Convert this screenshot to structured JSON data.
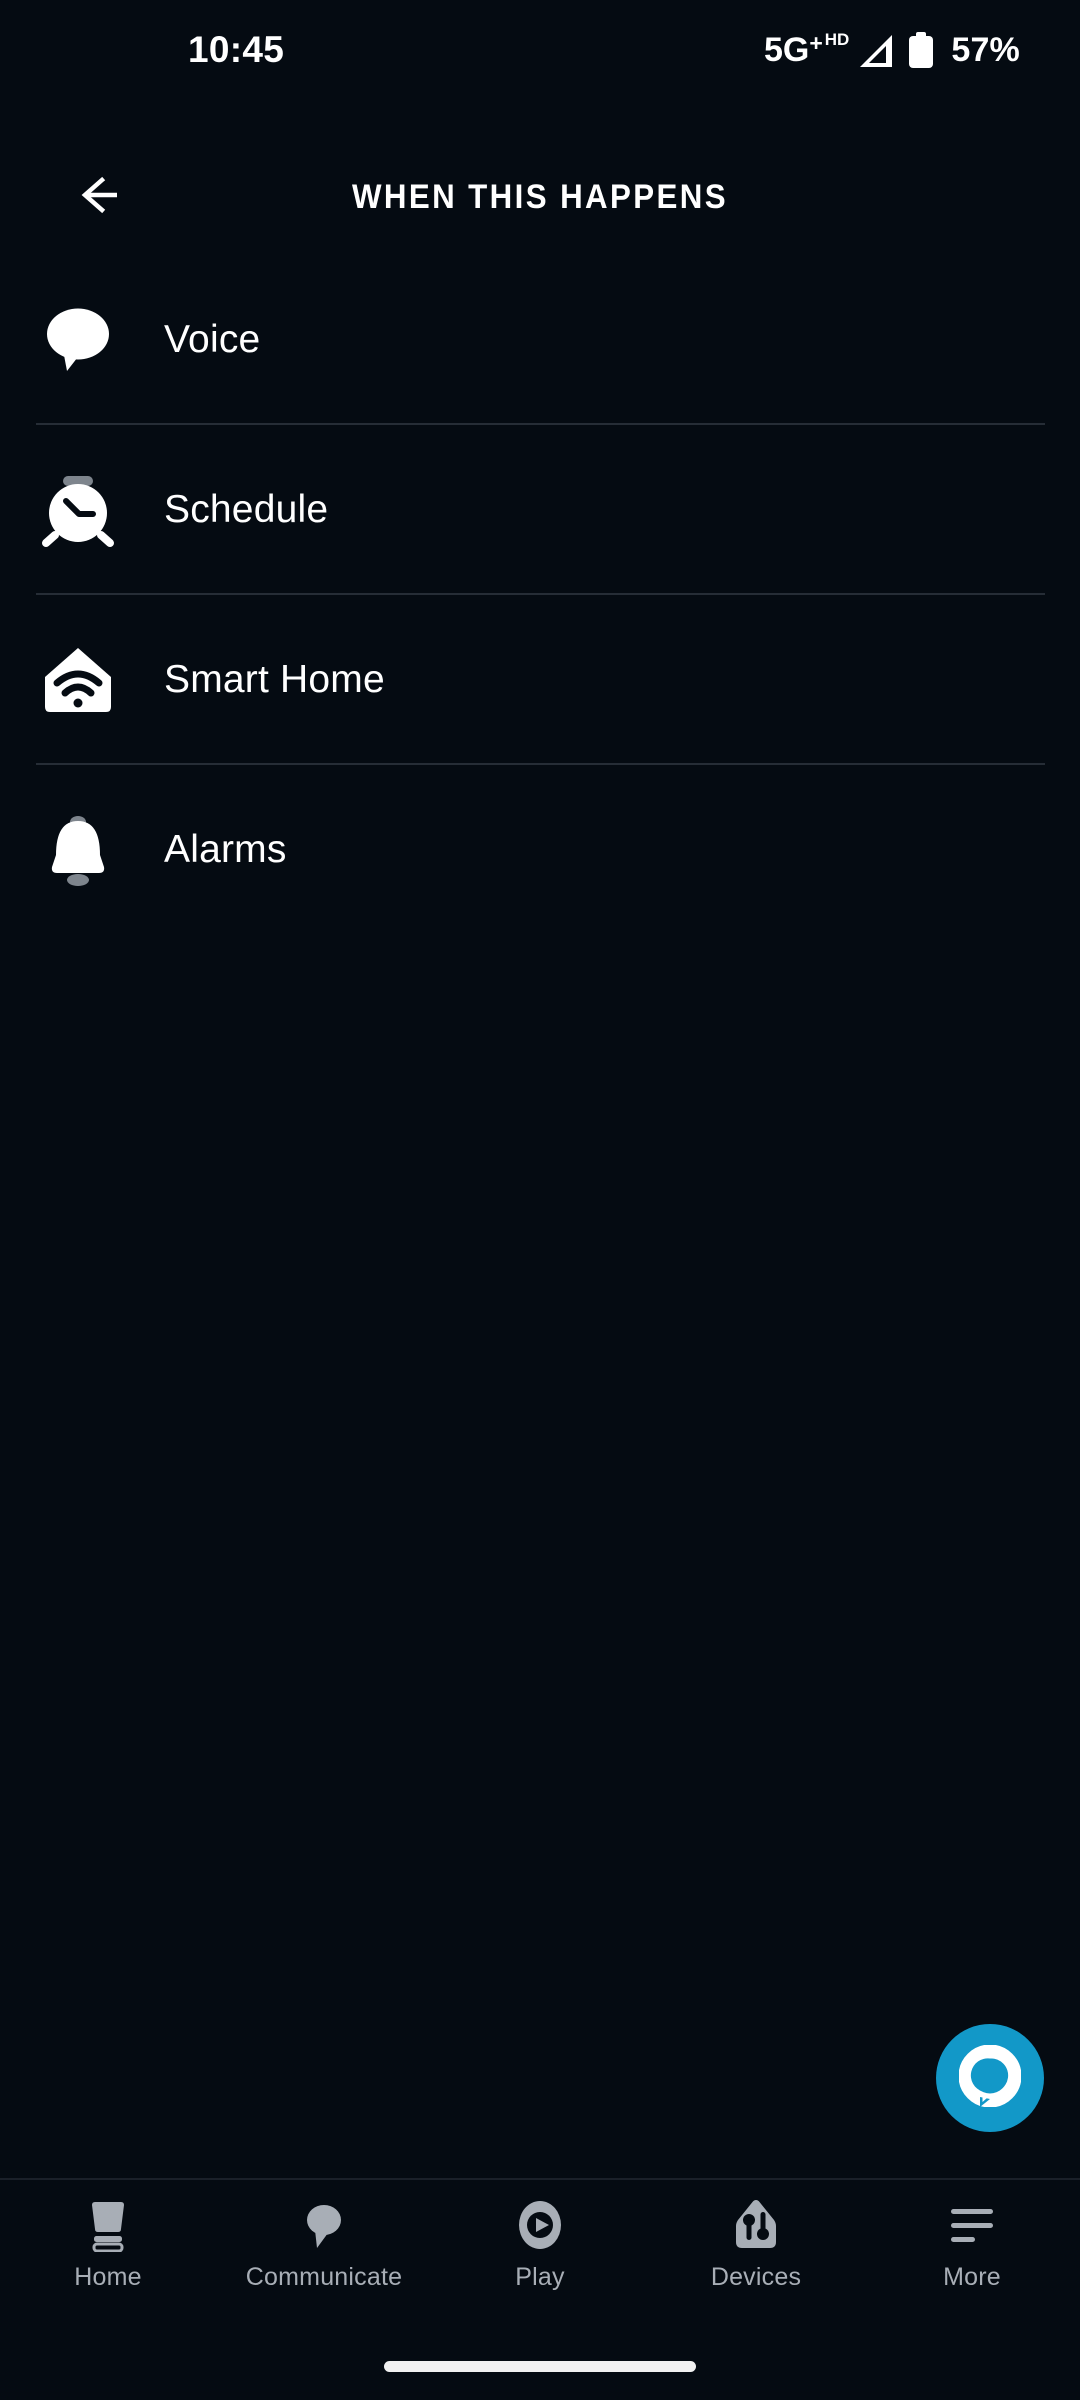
{
  "status_bar": {
    "time": "10:45",
    "network_type": "5G",
    "network_plus": "+",
    "voice_badge": "HD",
    "signal_icon": "signal-bars-icon",
    "battery_icon": "battery-icon",
    "battery_percent": "57%"
  },
  "header": {
    "back_icon": "back-arrow-icon",
    "title": "WHEN THIS HAPPENS"
  },
  "list": {
    "items": [
      {
        "label": "Voice",
        "icon": "speech-bubble-icon"
      },
      {
        "label": "Schedule",
        "icon": "alarm-clock-icon"
      },
      {
        "label": "Smart Home",
        "icon": "house-wifi-icon"
      },
      {
        "label": "Alarms",
        "icon": "bell-icon"
      }
    ]
  },
  "fab": {
    "label": "Alexa",
    "icon": "alexa-ring-icon",
    "color": "#1298c8"
  },
  "bottom_nav": {
    "items": [
      {
        "label": "Home",
        "icon": "echo-device-icon"
      },
      {
        "label": "Communicate",
        "icon": "speech-bubble-icon"
      },
      {
        "label": "Play",
        "icon": "play-circle-icon"
      },
      {
        "label": "Devices",
        "icon": "house-sliders-icon"
      },
      {
        "label": "More",
        "icon": "hamburger-menu-icon"
      }
    ]
  },
  "colors": {
    "background": "#050b12",
    "divider": "#262d36",
    "text_primary": "#ffffff",
    "nav_inactive": "#a8aeb6",
    "accent": "#1298c8"
  }
}
